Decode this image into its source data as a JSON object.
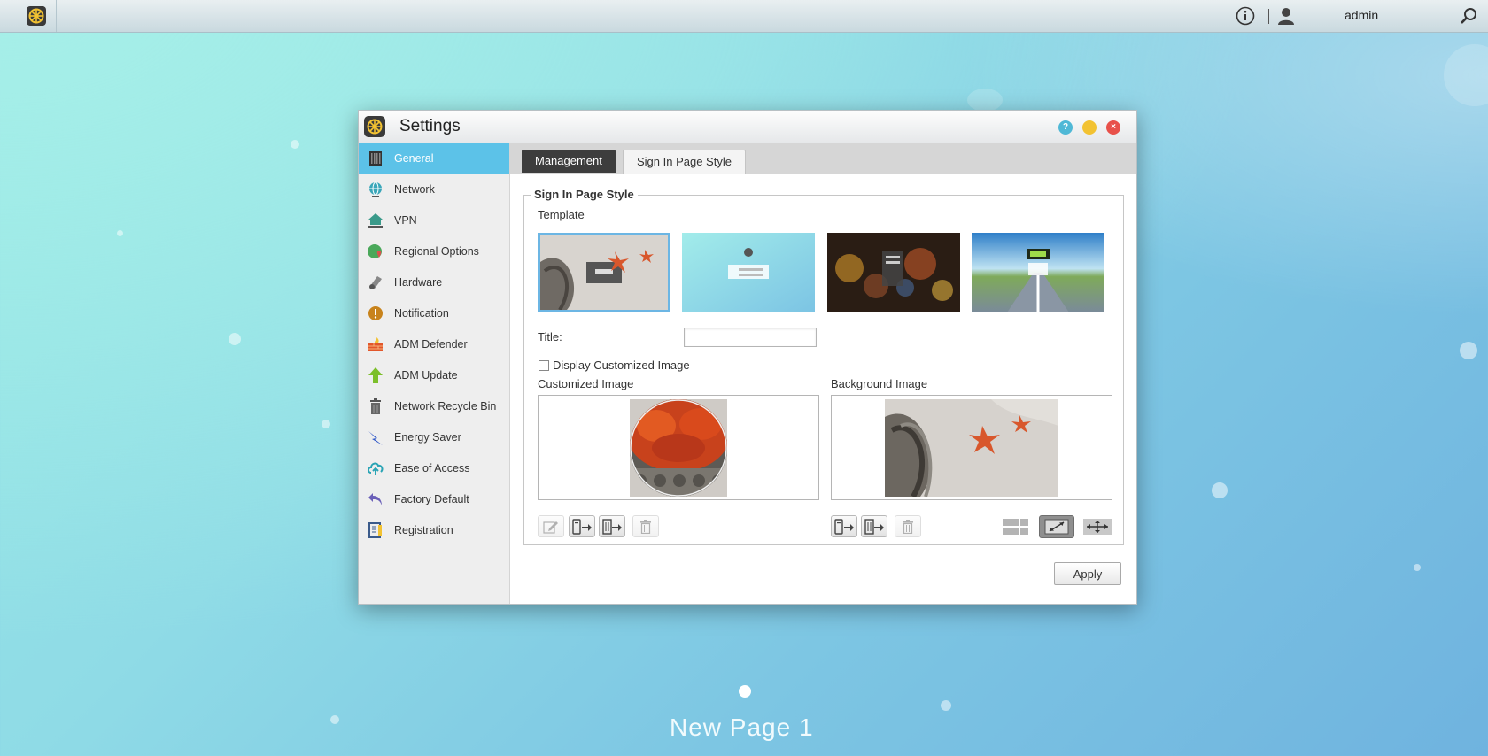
{
  "topbar": {
    "username": "admin",
    "icons": [
      "launcher-icon",
      "info-icon",
      "user-icon",
      "search-icon"
    ]
  },
  "window": {
    "title": "Settings",
    "controls": [
      "help-icon",
      "minimize-icon",
      "close-icon"
    ]
  },
  "sidebar": {
    "items": [
      {
        "label": "General",
        "icon": "general-icon",
        "active": true
      },
      {
        "label": "Network",
        "icon": "globe-icon"
      },
      {
        "label": "VPN",
        "icon": "vpn-icon"
      },
      {
        "label": "Regional Options",
        "icon": "regional-icon"
      },
      {
        "label": "Hardware",
        "icon": "hardware-icon"
      },
      {
        "label": "Notification",
        "icon": "notification-icon"
      },
      {
        "label": "ADM Defender",
        "icon": "defender-icon"
      },
      {
        "label": "ADM Update",
        "icon": "update-icon"
      },
      {
        "label": "Network Recycle Bin",
        "icon": "recycle-bin-icon"
      },
      {
        "label": "Energy Saver",
        "icon": "energy-icon"
      },
      {
        "label": "Ease of Access",
        "icon": "cloud-icon"
      },
      {
        "label": "Factory Default",
        "icon": "undo-icon"
      },
      {
        "label": "Registration",
        "icon": "registration-icon"
      }
    ]
  },
  "tabs": [
    {
      "label": "Management",
      "active": false
    },
    {
      "label": "Sign In Page Style",
      "active": true
    }
  ],
  "signin": {
    "section_title": "Sign In Page Style",
    "template_label": "Template",
    "title_label": "Title:",
    "title_value": "",
    "display_customized_label": "Display Customized Image",
    "display_customized_checked": false,
    "customized_image_label": "Customized Image",
    "background_image_label": "Background Image",
    "apply_label": "Apply"
  },
  "desktop": {
    "page_label": "New Page 1"
  },
  "colors": {
    "accent": "#5cc2e8",
    "active_tab_dark": "#3d3d3d"
  }
}
